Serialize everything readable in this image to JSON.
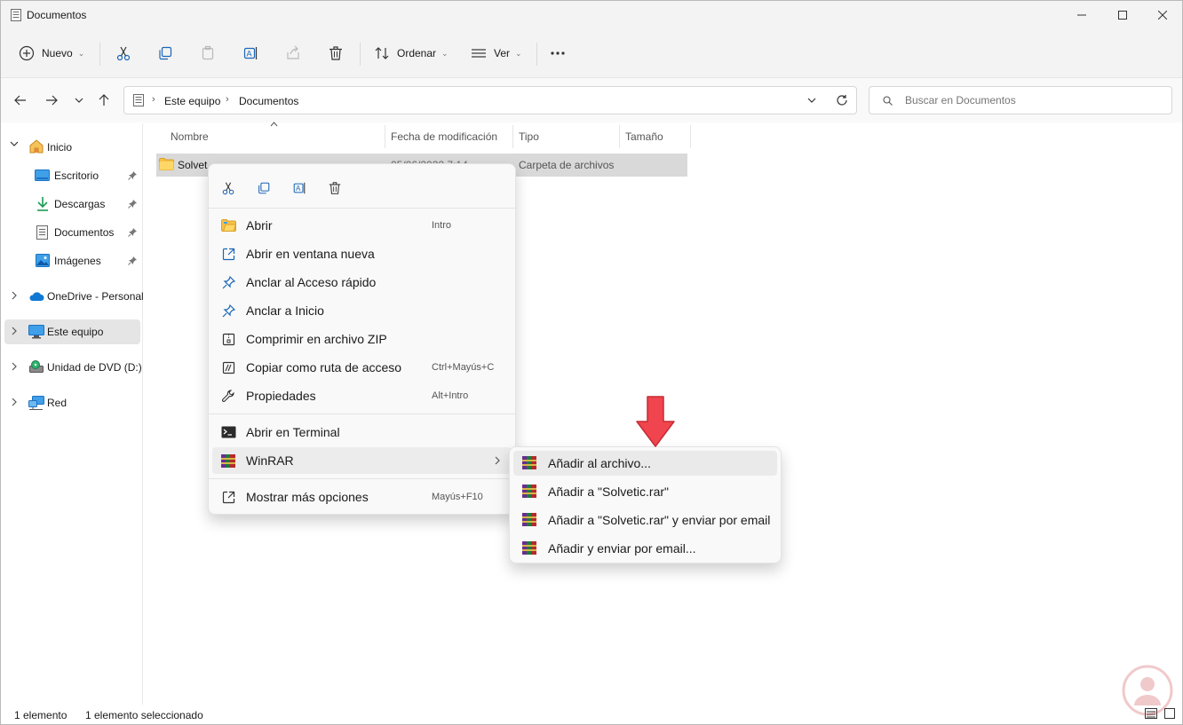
{
  "window": {
    "title": "Documentos"
  },
  "toolbar": {
    "new_label": "Nuevo",
    "sort_label": "Ordenar",
    "view_label": "Ver"
  },
  "address": {
    "crumbs": [
      "Este equipo",
      "Documentos"
    ]
  },
  "search": {
    "placeholder": "Buscar en Documentos"
  },
  "sidebar": {
    "items": [
      {
        "label": "Inicio",
        "icon": "home-icon"
      },
      {
        "label": "Escritorio",
        "icon": "desktop-icon",
        "pinned": true
      },
      {
        "label": "Descargas",
        "icon": "download-icon",
        "pinned": true
      },
      {
        "label": "Documentos",
        "icon": "document-icon",
        "pinned": true
      },
      {
        "label": "Imágenes",
        "icon": "pictures-icon",
        "pinned": true
      },
      {
        "label": "OneDrive - Personal",
        "icon": "cloud-icon"
      },
      {
        "label": "Este equipo",
        "icon": "computer-icon",
        "selected": true
      },
      {
        "label": "Unidad de DVD (D:)",
        "icon": "dvd-icon"
      },
      {
        "label": "Red",
        "icon": "network-icon"
      }
    ]
  },
  "columns": [
    "Nombre",
    "Fecha de modificación",
    "Tipo",
    "Tamaño"
  ],
  "files": [
    {
      "name": "Solvetic",
      "date": "05/06/2022 7:14",
      "type": "Carpeta de archivos",
      "size": ""
    }
  ],
  "context_menu": {
    "items": [
      {
        "label": "Abrir",
        "shortcut": "Intro",
        "icon": "folder-open-icon"
      },
      {
        "label": "Abrir en ventana nueva",
        "shortcut": "",
        "icon": "open-new-window-icon"
      },
      {
        "label": "Anclar al Acceso rápido",
        "shortcut": "",
        "icon": "pin-icon"
      },
      {
        "label": "Anclar a Inicio",
        "shortcut": "",
        "icon": "pin-icon"
      },
      {
        "label": "Comprimir en archivo ZIP",
        "shortcut": "",
        "icon": "zip-icon"
      },
      {
        "label": "Copiar como ruta de acceso",
        "shortcut": "Ctrl+Mayús+C",
        "icon": "copy-path-icon"
      },
      {
        "label": "Propiedades",
        "shortcut": "Alt+Intro",
        "icon": "wrench-icon"
      },
      {
        "label": "Abrir en Terminal",
        "shortcut": "",
        "icon": "terminal-icon"
      },
      {
        "label": "WinRAR",
        "shortcut": "",
        "icon": "winrar-icon"
      },
      {
        "label": "Mostrar más opciones",
        "shortcut": "Mayús+F10",
        "icon": "more-options-icon"
      }
    ]
  },
  "winrar_submenu": {
    "items": [
      {
        "label": "Añadir al archivo..."
      },
      {
        "label": "Añadir a \"Solvetic.rar\""
      },
      {
        "label": "Añadir a \"Solvetic.rar\" y enviar por email"
      },
      {
        "label": "Añadir y enviar por email..."
      }
    ]
  },
  "status": {
    "count": "1 elemento",
    "selected": "1 elemento seleccionado"
  },
  "colors": {
    "accent": "#0067c0",
    "arrow": "#f0454e",
    "selection": "#d9d9d9"
  }
}
